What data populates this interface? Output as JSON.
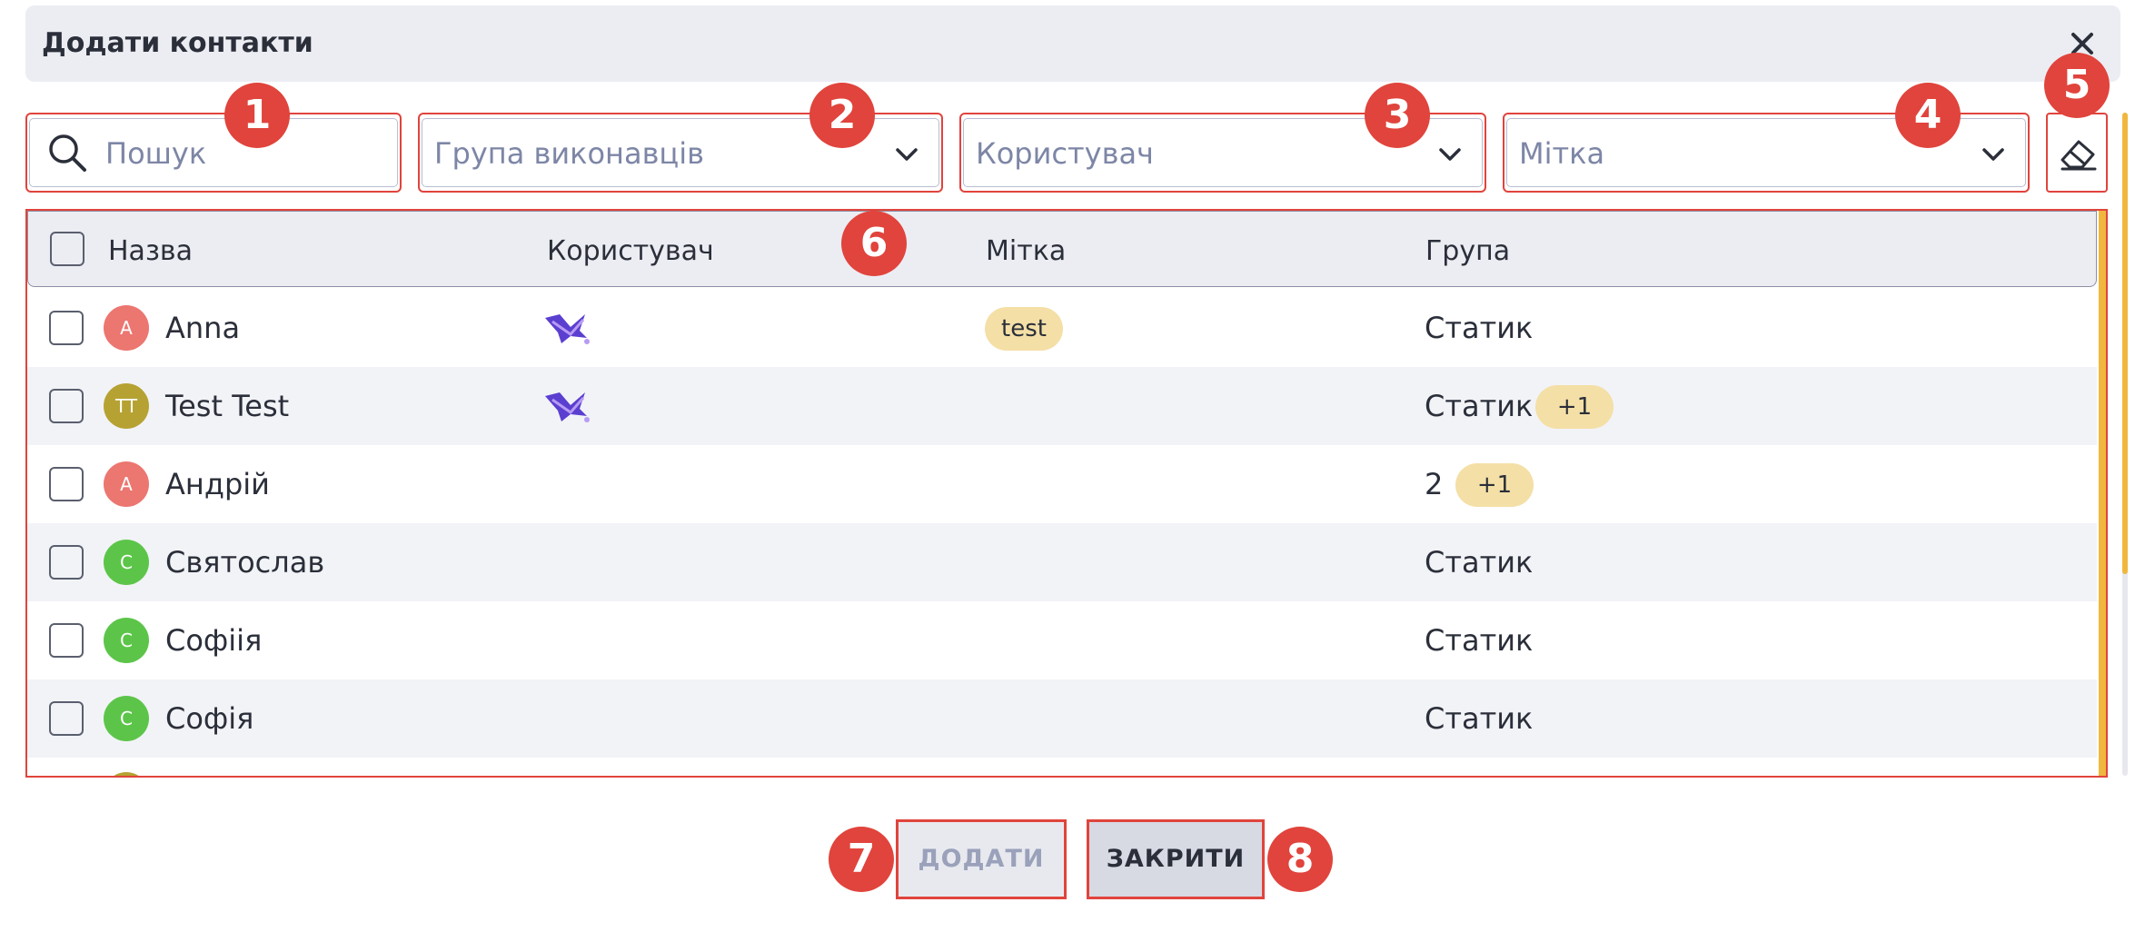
{
  "dialog": {
    "title": "Додати контакти",
    "close_icon": "close-icon"
  },
  "filters": {
    "search_placeholder": "Пошук",
    "group_placeholder": "Група виконавців",
    "user_placeholder": "Користувач",
    "label_placeholder": "Мітка",
    "clear_icon": "eraser-icon"
  },
  "table": {
    "headers": [
      "Назва",
      "Користувач",
      "Мітка",
      "Група"
    ],
    "rows": [
      {
        "initials": "A",
        "avatar_color": "#ec7670",
        "name": "Anna",
        "user_icon": "service-logo-icon",
        "tag": "test",
        "group": "Статик",
        "extra": ""
      },
      {
        "initials": "TT",
        "avatar_color": "#b6a232",
        "name": "Test Test",
        "user_icon": "service-logo-icon",
        "tag": "",
        "group": "Статик",
        "extra": "+1"
      },
      {
        "initials": "A",
        "avatar_color": "#ec7670",
        "name": "Андрій",
        "user_icon": "",
        "tag": "",
        "group": "2",
        "extra": "+1"
      },
      {
        "initials": "C",
        "avatar_color": "#5cc549",
        "name": "Святослав",
        "user_icon": "",
        "tag": "",
        "group": "Статик",
        "extra": ""
      },
      {
        "initials": "C",
        "avatar_color": "#5cc549",
        "name": "Софіія",
        "user_icon": "",
        "tag": "",
        "group": "Статик",
        "extra": ""
      },
      {
        "initials": "C",
        "avatar_color": "#5cc549",
        "name": "Софія",
        "user_icon": "",
        "tag": "",
        "group": "Статик",
        "extra": ""
      }
    ]
  },
  "actions": {
    "add_label": "ДОДАТИ",
    "close_label": "ЗАКРИТИ"
  },
  "annotations": [
    "1",
    "2",
    "3",
    "4",
    "5",
    "6",
    "7",
    "8"
  ],
  "colors": {
    "annotation_red": "#e0443c",
    "accent_yellow": "#f0b73f",
    "tag_bg": "#f4dfa6",
    "header_bg": "#ecedf3"
  }
}
